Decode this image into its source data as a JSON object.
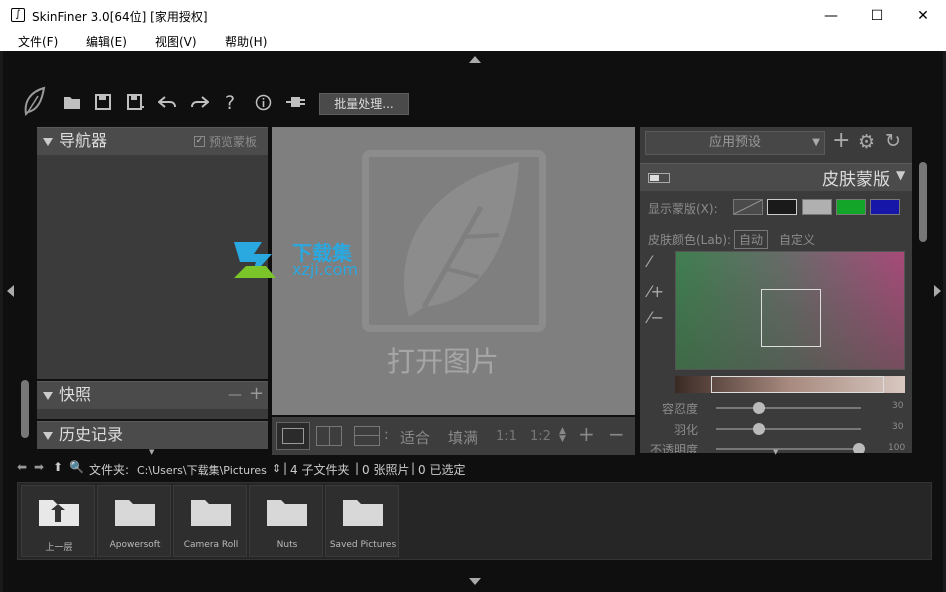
{
  "window": {
    "title": "SkinFiner 3.0[64位] [家用授权]",
    "minimize": "—",
    "maximize": "☐",
    "close": "✕"
  },
  "menu": [
    "文件(F)",
    "编辑(E)",
    "视图(V)",
    "帮助(H)"
  ],
  "toolbar": {
    "batch_label": "批量处理..."
  },
  "navigator": {
    "title": "导航器",
    "preview_mask_label": "预览蒙板"
  },
  "snapshot": {
    "title": "快照",
    "minus": "—",
    "plus": "+"
  },
  "history": {
    "title": "历史记录"
  },
  "canvas": {
    "open_label": "打开图片",
    "watermark_cn": "下载集",
    "watermark_url": "xzji.com"
  },
  "zoom_bar": {
    "fit": "适合",
    "fill": "填满",
    "r11": "1:1",
    "r12": "1:2"
  },
  "preset": {
    "label": "应用预设",
    "add": "+",
    "gear": "⚙",
    "reset": "↻"
  },
  "skin_mask": {
    "title": "皮肤蒙版",
    "show_mask_label": "显示蒙版(X):",
    "skin_color_label": "皮肤颜色(Lab):",
    "auto_label": "自动",
    "custom_label": "自定义",
    "colors": {
      "swatch_black": "#1a1a1a",
      "swatch_gray": "#b0b0b0",
      "swatch_green": "#12a52a",
      "swatch_blue": "#1616a8"
    }
  },
  "sliders": [
    {
      "label": "容忍度",
      "value": "30"
    },
    {
      "label": "羽化",
      "value": "30"
    },
    {
      "label": "不透明度",
      "value": "100"
    }
  ],
  "pathbar": {
    "folder_label": "文件夹:",
    "path": "C:\\Users\\下载集\\Pictures",
    "subfolders": "4 子文件夹",
    "photos": "0 张照片",
    "selected": "0 已选定"
  },
  "folders": [
    "上一层",
    "Apowersoft",
    "Camera Roll",
    "Nuts",
    "Saved Pictures"
  ]
}
